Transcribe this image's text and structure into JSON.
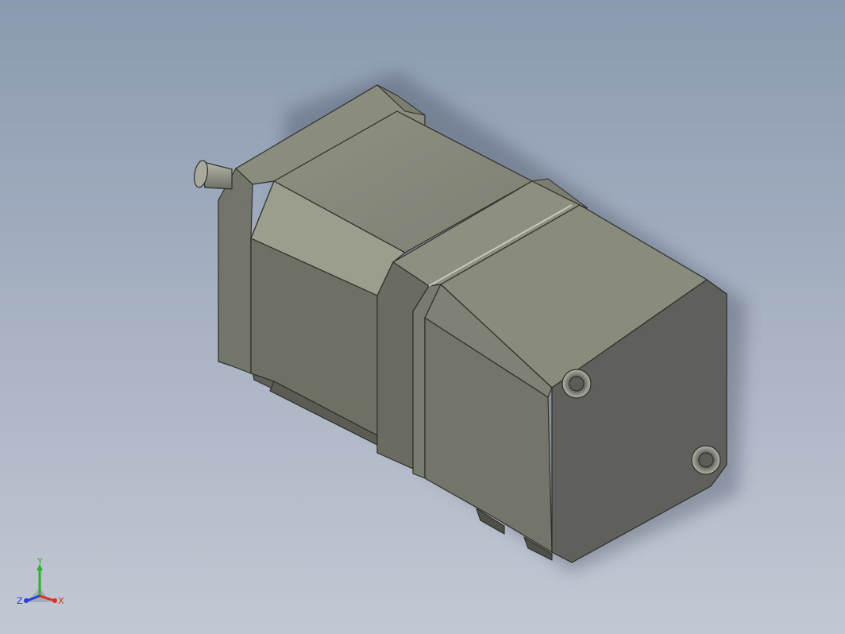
{
  "viewport": {
    "background_top": "#8b9ab0",
    "background_bottom": "#c2c8d3",
    "model": "stepper-motor-with-gearbox"
  },
  "triad": {
    "x_label": "X",
    "y_label": "Y",
    "z_label": "Z",
    "x_color": "#e0301e",
    "y_color": "#2fb02f",
    "z_color": "#2a3fd8"
  }
}
